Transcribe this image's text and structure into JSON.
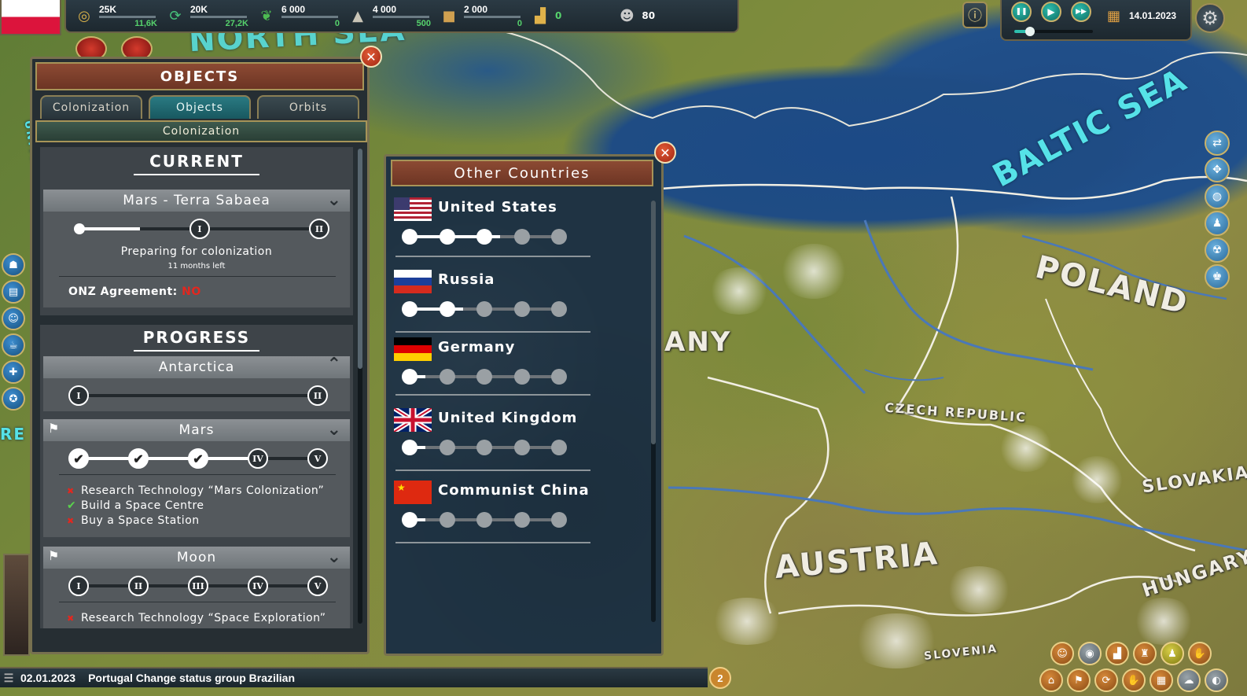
{
  "topbar": {
    "resources": [
      {
        "icon": "coins-icon",
        "glyph": "◎",
        "color": "#d9b24a",
        "top": "25K",
        "bottom": "11,6K"
      },
      {
        "icon": "cycle-icon",
        "glyph": "⟳",
        "color": "#46c07a",
        "top": "20K",
        "bottom": "27,2K"
      },
      {
        "icon": "plant-icon",
        "glyph": "❦",
        "color": "#4dbb52",
        "top": "6 000",
        "bottom": "0"
      },
      {
        "icon": "ore-icon",
        "glyph": "▲",
        "color": "#c9c4b6",
        "top": "4 000",
        "bottom": "500"
      },
      {
        "icon": "crate-icon",
        "glyph": "■",
        "color": "#d0a050",
        "top": "2 000",
        "bottom": "0"
      }
    ],
    "economy_value": "0",
    "population_value": "80"
  },
  "time": {
    "date": "14.01.2023",
    "pause": "❚❚",
    "play": "▶",
    "fast": "▶▶",
    "speed_fraction": 0.2
  },
  "map_labels": {
    "north_sea": "NORTH SEA",
    "baltic_sea": "BALTIC SEA",
    "poland": "POLAND",
    "germany": "ANY",
    "czech": "CZECH REPUBLIC",
    "austria": "AUSTRIA",
    "slovakia": "SLOVAKIA",
    "hungary": "HUNGARY",
    "slovenia": "SLOVENIA",
    "left_edge": "UNITED",
    "left_edge2": "RE"
  },
  "objects_panel": {
    "title": "OBJECTS",
    "tabs": [
      "Colonization",
      "Objects",
      "Orbits"
    ],
    "active_tab": 1,
    "subheader": "Colonization",
    "current": {
      "title": "CURRENT",
      "target": "Mars - Terra Sabaea",
      "stage_labels": [
        "I",
        "II"
      ],
      "progress_fraction": 0.5,
      "status": "Preparing for colonization",
      "time_left": "11 months left",
      "agreement_label": "ONZ Agreement:",
      "agreement_value": "NO"
    },
    "progress": {
      "title": "PROGRESS",
      "items": [
        {
          "name": "Antarctica",
          "stages": [
            "I",
            "II"
          ]
        },
        {
          "name": "Mars",
          "stages": [
            "✔",
            "✔",
            "✔",
            "IV",
            "V"
          ],
          "requirements": [
            {
              "status": "x",
              "text": "Research Technology “Mars Colonization”"
            },
            {
              "status": "ok",
              "text": "Build a Space Centre"
            },
            {
              "status": "x",
              "text": "Buy a Space Station"
            }
          ]
        },
        {
          "name": "Moon",
          "stages": [
            "I",
            "II",
            "III",
            "IV",
            "V"
          ],
          "requirements": [
            {
              "status": "x",
              "text": "Research Technology “Space Exploration”"
            }
          ]
        }
      ]
    }
  },
  "other_countries": {
    "title": "Other Countries",
    "countries": [
      {
        "name": "United States",
        "level": 3
      },
      {
        "name": "Russia",
        "level": 2
      },
      {
        "name": "Germany",
        "level": 1
      },
      {
        "name": "United Kingdom",
        "level": 1
      },
      {
        "name": "Communist China",
        "level": 1
      }
    ]
  },
  "status": {
    "date": "02.01.2023",
    "message": "Portugal Change status group Brazilian",
    "count": "2"
  },
  "colors": {
    "accent": "#8c4a33",
    "teal": "#2a7a82",
    "panel": "#262e33"
  }
}
